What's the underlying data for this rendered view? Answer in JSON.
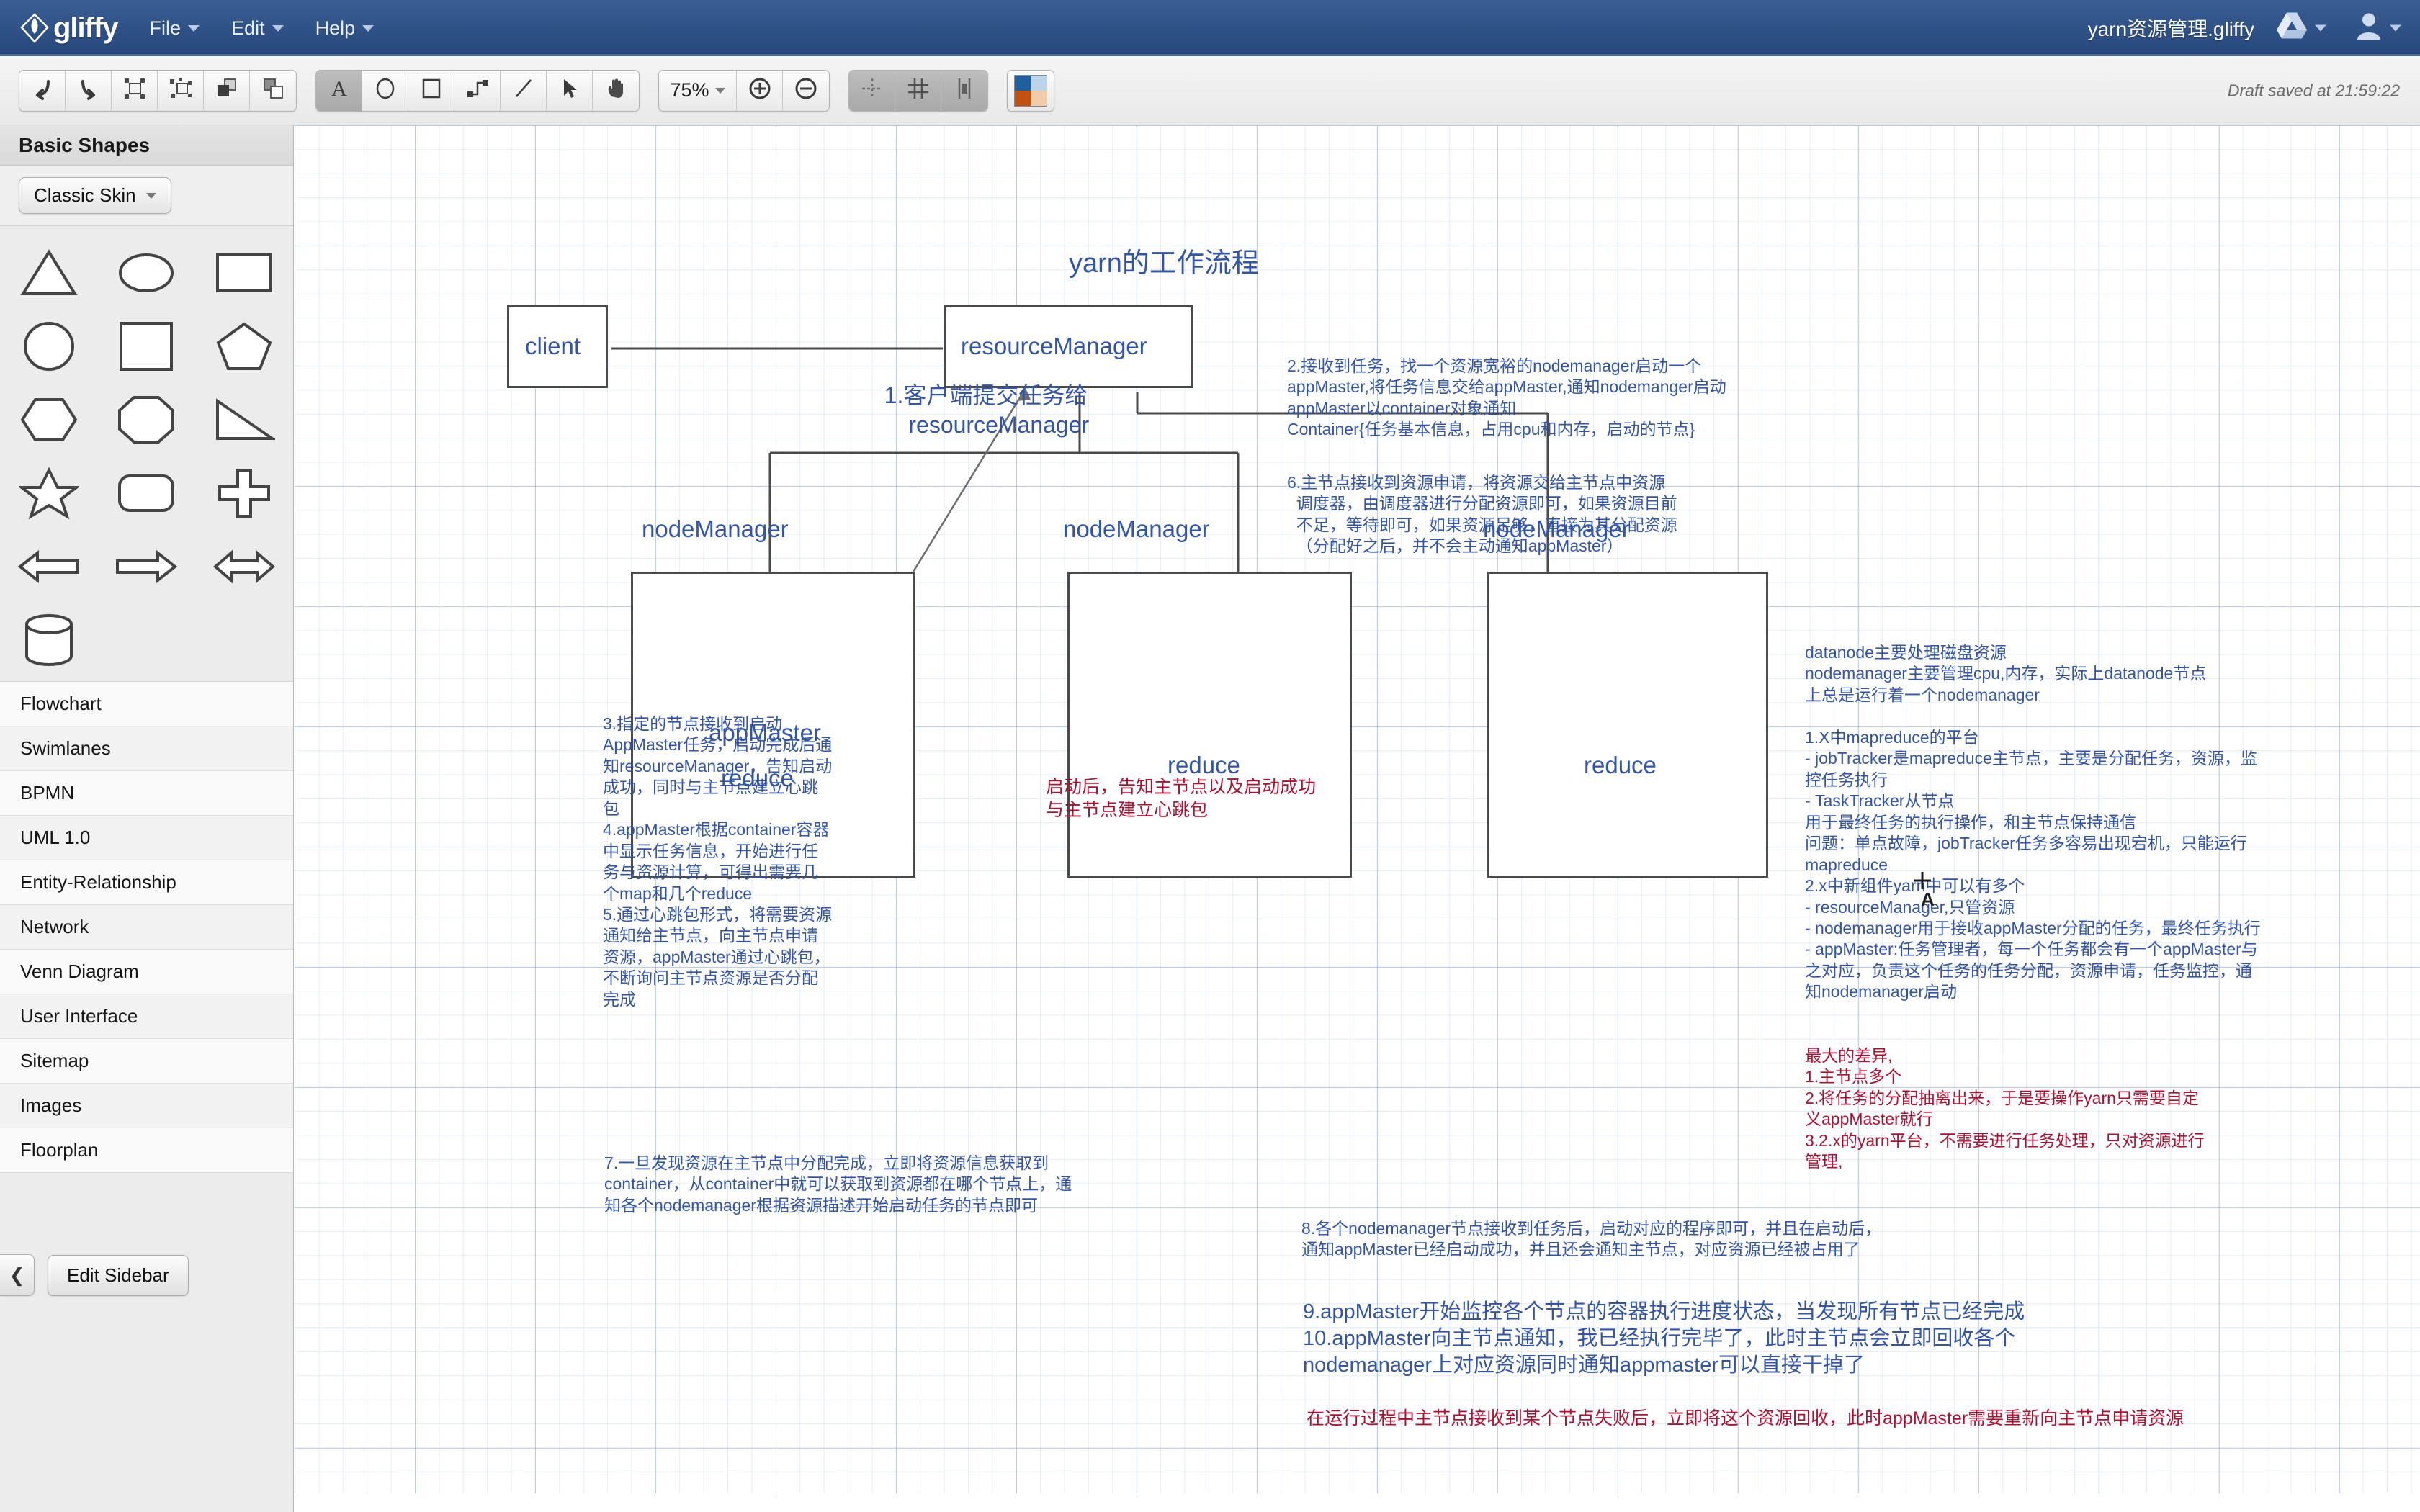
{
  "header": {
    "logo_text": "gliffy",
    "menus": [
      "File",
      "Edit",
      "Help"
    ],
    "doc_title": "yarn资源管理.gliffy",
    "drive_icon": "google-drive-icon",
    "user_icon": "user-account-icon"
  },
  "toolbar": {
    "zoom_level": "75%",
    "draft_status": "Draft saved at 21:59:22",
    "buttons": [
      "undo-icon",
      "redo-icon",
      "select-all-icon",
      "deselect-icon",
      "bring-to-front-icon",
      "send-to-back-icon",
      "text-tool-icon",
      "ellipse-tool-icon",
      "rectangle-tool-icon",
      "connector-tool-icon",
      "line-tool-icon",
      "pointer-tool-icon",
      "hand-tool-icon",
      "zoom-in-icon",
      "zoom-out-icon",
      "snap-to-guides-icon",
      "show-grid-icon",
      "rulers-icon",
      "theme-swatch-icon"
    ]
  },
  "sidebar": {
    "title": "Basic Shapes",
    "skin": "Classic Skin",
    "shapes": [
      "triangle",
      "ellipse",
      "rectangle-wide",
      "circle",
      "square",
      "pentagon",
      "hexagon",
      "octagon",
      "right-triangle",
      "star",
      "rounded-rectangle",
      "cross",
      "arrow-left",
      "arrow-right",
      "arrow-left-right",
      "cylinder"
    ],
    "categories": [
      "Flowchart",
      "Swimlanes",
      "BPMN",
      "UML 1.0",
      "Entity-Relationship",
      "Network",
      "Venn Diagram",
      "User Interface",
      "Sitemap",
      "Images",
      "Floorplan"
    ],
    "collapse_label": "❮",
    "edit_sidebar_label": "Edit Sidebar"
  },
  "diagram": {
    "title": "yarn的工作流程",
    "nodes": [
      {
        "id": "client",
        "label": "client"
      },
      {
        "id": "resourceManager",
        "label": "resourceManager"
      },
      {
        "id": "nodeManager1",
        "label": "nodeManager"
      },
      {
        "id": "nodeManager2",
        "label": "nodeManager"
      },
      {
        "id": "nodeManager3",
        "label": "nodeManager"
      },
      {
        "id": "appMaster",
        "label": "appMaster"
      },
      {
        "id": "reduce1",
        "label": "reduce"
      },
      {
        "id": "reduce2",
        "label": "reduce"
      },
      {
        "id": "reduce3",
        "label": "reduce"
      }
    ],
    "annotations": {
      "step1": "1.客户端提交任务给\n    resourceManager",
      "step2": "2.接收到任务，找一个资源宽裕的nodemanager启动一个\nappMaster,将任务信息交给appMaster,通知nodemanger启动\nappMaster以container对象通知\nContainer{任务基本信息，占用cpu和内存，启动的节点}",
      "step6": "6.主节点接收到资源申请，将资源交给主节点中资源\n  调度器，由调度器进行分配资源即可，如果资源目前\n  不足，等待即可，如果资源足够，直接为其分配资源\n  （分配好之后，并不会主动通知appMaster）",
      "steps345": "3.指定的节点接收到启动\nAppMaster任务，启动完成后通\n知resourceManager，告知启动\n成功，同时与主节点建立心跳\n包\n4.appMaster根据container容器\n中显示任务信息，开始进行任\n务与资源计算，可得出需要几\n个map和几个reduce\n5.通过心跳包形式，将需要资源\n通知给主节点，向主节点申请\n资源，appMaster通过心跳包，\n不断询问主节点资源是否分配\n完成",
      "center_red": "启动后，告知主节点以及启动成功\n与主节点建立心跳包",
      "step7": "7.一旦发现资源在主节点中分配完成，立即将资源信息获取到\ncontainer，从container中就可以获取到资源都在哪个节点上，通\n知各个nodemanager根据资源描述开始启动任务的节点即可",
      "step8": "8.各个nodemanager节点接收到任务后，启动对应的程序即可，并且在启动后，\n通知appMaster已经启动成功，并且还会通知主节点，对应资源已经被占用了",
      "step910": "9.appMaster开始监控各个节点的容器执行进度状态，当发现所有节点已经完成\n10.appMaster向主节点通知，我已经执行完毕了，此时主节点会立即回收各个\nnodemanager上对应资源同时通知appmaster可以直接干掉了",
      "bottom_red": "在运行过程中主节点接收到某个节点失败后，立即将这个资源回收，此时appMaster需要重新向主节点申请资源",
      "right_note1": "datanode主要处理磁盘资源\nnodemanager主要管理cpu,内存，实际上datanode节点\n上总是运行着一个nodemanager",
      "right_note2": "1.X中mapreduce的平台\n- jobTracker是mapreduce主节点，主要是分配任务，资源，监\n控任务执行\n- TaskTracker从节点\n用于最终任务的执行操作，和主节点保持通信\n问题：单点故障，jobTracker任务多容易出现宕机，只能运行\nmapreduce\n2.x中新组件yarn中可以有多个\n- resourceManager,只管资源\n- nodemanager用于接收appMaster分配的任务，最终任务执行\n- appMaster:任务管理者，每一个任务都会有一个appMaster与\n之对应，负责这个任务的任务分配，资源申请，任务监控，通\n知nodemanager启动",
      "right_red": "最大的差异,\n1.主节点多个\n2.将任务的分配抽离出来，于是要操作yarn只需要自定\n义appMaster就行\n3.2.x的yarn平台，不需要进行任务处理，只对资源进行\n管理,",
      "text_cursor": "A"
    }
  },
  "colors": {
    "header_blue": "#2e5186",
    "diagram_blue": "#3355a8",
    "diagram_red": "#b01030",
    "node_stroke": "#4a4a4a"
  }
}
